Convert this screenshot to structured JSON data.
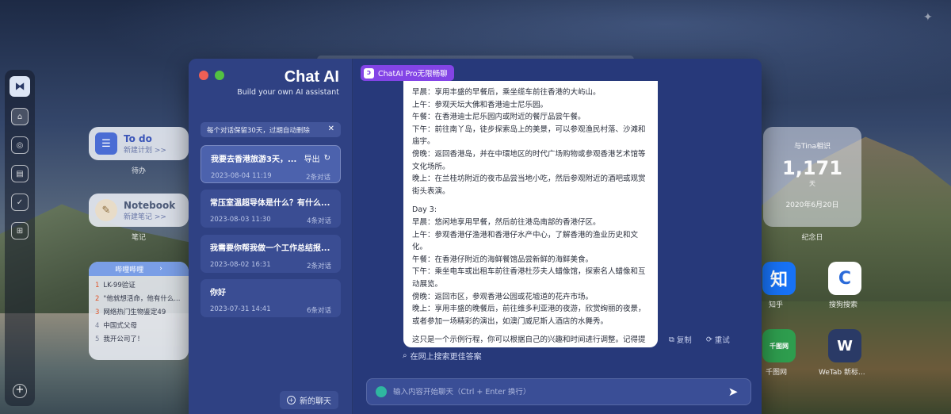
{
  "desktop": {
    "widgets": {
      "todo": {
        "title": "To do",
        "subtitle": "新建计划 >>",
        "caption": "待办"
      },
      "notebook": {
        "title": "Notebook",
        "subtitle": "新建笔记 >>",
        "caption": "笔记"
      },
      "hotlist": {
        "header": "哔哩哔哩",
        "items": [
          {
            "rank": "1",
            "text": "LK-99验证"
          },
          {
            "rank": "2",
            "text": "\"他就想活命，他有什么..."
          },
          {
            "rank": "3",
            "text": "网络热门生物鉴定49"
          },
          {
            "rank": "4",
            "text": "中国式父母"
          },
          {
            "rank": "5",
            "text": "我开公司了！"
          }
        ]
      },
      "countdown": {
        "label": "与Tina相识",
        "number": "1,171",
        "unit": "天",
        "date": "2020年6月20日",
        "caption": "纪念日"
      }
    },
    "apps": [
      {
        "name": "知乎",
        "glyph": "知",
        "color": "#1772f6"
      },
      {
        "name": "搜狗搜索",
        "glyph": "C",
        "color": "#2b6bd9"
      },
      {
        "name": "千图网",
        "glyph": "千图网",
        "color": "#2e9d4e"
      },
      {
        "name": "WeTab 新标...",
        "glyph": "W",
        "color": "#2a3a66"
      }
    ]
  },
  "chat_app": {
    "brand": {
      "title": "Chat AI",
      "subtitle": "Build your own AI assistant"
    },
    "notice": "每个对话保留30天，过期自动删除",
    "pro_badge": "ChatAI Pro无限畅聊",
    "conversations": [
      {
        "title": "我要去香港旅游3天，...",
        "date": "2023-08-04 11:19",
        "count": "2条对话",
        "export_label": "导出",
        "active": true
      },
      {
        "title": "常压室温超导体是什么？有什么...",
        "date": "2023-08-03 11:30",
        "count": "4条对话"
      },
      {
        "title": "我需要你帮我做一个工作总结报...",
        "date": "2023-08-02 16:31",
        "count": "2条对话"
      },
      {
        "title": "你好",
        "date": "2023-07-31 14:41",
        "count": "6条对话"
      }
    ],
    "new_chat_label": "新的聊天",
    "message_lines": [
      "早晨：享用丰盛的早餐后，乘坐缆车前往香港的大屿山。",
      "上午：参观天坛大佛和香港迪士尼乐园。",
      "午餐：在香港迪士尼乐园内或附近的餐厅品尝午餐。",
      "下午：前往南丫岛，徒步探索岛上的美景，可以参观渔民村落、沙滩和庙宇。",
      "傍晚：返回香港岛，并在中環地区的时代广场购物或参观香港艺术馆等文化场所。",
      "晚上：在兰桂坊附近的夜市品尝当地小吃，然后参观附近的酒吧或观赏街头表演。",
      "",
      "Day 3:",
      "早晨：悠闲地享用早餐，然后前往港岛南部的香港仔区。",
      "上午：参观香港仔渔港和香港仔水产中心，了解香港的渔业历史和文化。",
      "午餐：在香港仔附近的海鲜餐馆品尝新鲜的海鲜美食。",
      "下午：乘坐电车或出租车前往香港杜莎夫人蜡像馆，探索名人蜡像和互动展览。",
      "傍晚：返回市区，参观香港公园或花墟道的花卉市场。",
      "晚上：享用丰盛的晚餐后，前往维多利亚港的夜游，欣赏绚丽的夜景，或者参加一场精彩的演出，如澳门威尼斯人酒店的水舞秀。",
      "",
      "这只是一个示例行程，你可以根据自己的兴趣和时间进行调整。记得提前了解景点的开放时间和预订相关门票，以确保行程顺利。祝您旅游愉快！如果还有其他问题，随时告诉我。"
    ],
    "copy_label": "复制",
    "retry_label": "重试",
    "search_link": "在网上搜索更佳答案",
    "input_placeholder": "输入内容开始聊天（Ctrl + Enter 换行）"
  }
}
